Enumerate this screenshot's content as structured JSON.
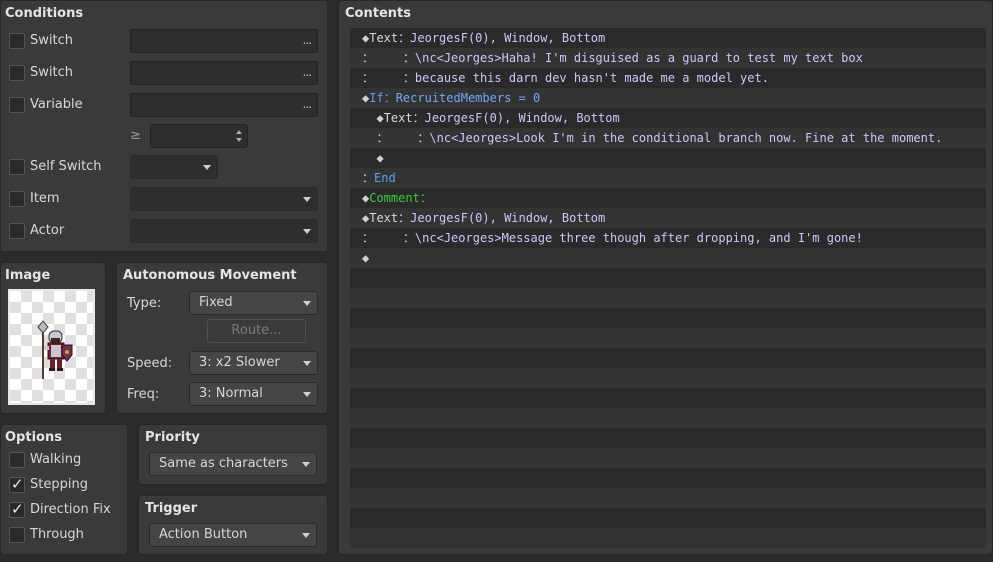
{
  "conditions": {
    "title": "Conditions",
    "switch1_label": "Switch",
    "switch2_label": "Switch",
    "variable_label": "Variable",
    "gte_symbol": "≥",
    "self_switch_label": "Self Switch",
    "item_label": "Item",
    "actor_label": "Actor",
    "ellipsis": "..."
  },
  "image": {
    "title": "Image"
  },
  "autonomous": {
    "title": "Autonomous Movement",
    "type_label": "Type:",
    "type_value": "Fixed",
    "route_label": "Route...",
    "speed_label": "Speed:",
    "speed_value": "3: x2 Slower",
    "freq_label": "Freq:",
    "freq_value": "3: Normal"
  },
  "options": {
    "title": "Options",
    "walking": "Walking",
    "stepping": "Stepping",
    "direction_fix": "Direction Fix",
    "through": "Through",
    "walking_checked": false,
    "stepping_checked": true,
    "direction_fix_checked": true,
    "through_checked": false
  },
  "priority": {
    "title": "Priority",
    "value": "Same as characters"
  },
  "trigger": {
    "title": "Trigger",
    "value": "Action Button"
  },
  "contents": {
    "title": "Contents",
    "lines": [
      {
        "prefix": "◆",
        "cmd": "Text",
        "sep": "：",
        "body": "JeorgesF(0), Window, Bottom",
        "style": "normal"
      },
      {
        "prefix": "：    ",
        "cmd": "",
        "sep": "：",
        "body": "\\nc<Jeorges>Haha! I'm disguised as a guard to test my text box",
        "style": "normal"
      },
      {
        "prefix": "：    ",
        "cmd": "",
        "sep": "：",
        "body": "because this darn dev hasn't made me a model yet.",
        "style": "normal"
      },
      {
        "prefix": "◆",
        "cmd": "If",
        "sep": "：",
        "body": "RecruitedMembers = 0",
        "style": "blue"
      },
      {
        "prefix": "  ◆",
        "cmd": "Text",
        "sep": "：",
        "body": "JeorgesF(0), Window, Bottom",
        "style": "normal"
      },
      {
        "prefix": "  ：    ",
        "cmd": "",
        "sep": "：",
        "body": "\\nc<Jeorges>Look I'm in the conditional branch now. Fine at the moment.",
        "style": "normal"
      },
      {
        "prefix": "  ◆",
        "cmd": "",
        "sep": "",
        "body": "",
        "style": "normal"
      },
      {
        "prefix": "：",
        "cmd": "End",
        "sep": "",
        "body": "",
        "style": "blue"
      },
      {
        "prefix": "◆",
        "cmd": "Comment",
        "sep": "：",
        "body": "",
        "style": "green"
      },
      {
        "prefix": "◆",
        "cmd": "Text",
        "sep": "：",
        "body": "JeorgesF(0), Window, Bottom",
        "style": "normal"
      },
      {
        "prefix": "：    ",
        "cmd": "",
        "sep": "：",
        "body": "\\nc<Jeorges>Message three though after dropping, and I'm gone!",
        "style": "normal"
      },
      {
        "prefix": "◆",
        "cmd": "",
        "sep": "",
        "body": "",
        "style": "normal"
      }
    ]
  }
}
